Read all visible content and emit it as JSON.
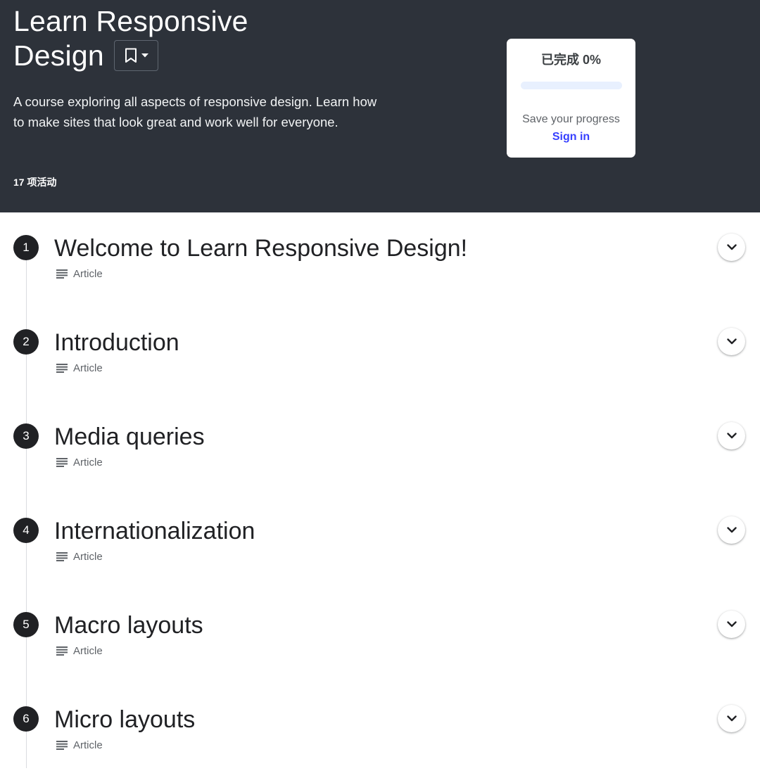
{
  "header": {
    "title": "Learn Responsive\nDesign",
    "description": "A course exploring all aspects of responsive design. Learn how to make sites that look great and work well for everyone.",
    "activity_count": "17 项活动",
    "bookmark_icon": "bookmark-icon",
    "dropdown_icon": "caret-down-icon"
  },
  "progress": {
    "label": "已完成 0%",
    "percent": 0,
    "save_text": "Save your progress",
    "sign_in_label": "Sign in"
  },
  "colors": {
    "header_bg": "#2d323a",
    "accent": "#3740ff",
    "track": "#e8f0fe"
  },
  "lessons": [
    {
      "number": "1",
      "title": "Welcome to Learn Responsive Design!",
      "type": "Article",
      "type_icon": "article-icon"
    },
    {
      "number": "2",
      "title": "Introduction",
      "type": "Article",
      "type_icon": "article-icon"
    },
    {
      "number": "3",
      "title": "Media queries",
      "type": "Article",
      "type_icon": "article-icon"
    },
    {
      "number": "4",
      "title": "Internationalization",
      "type": "Article",
      "type_icon": "article-icon"
    },
    {
      "number": "5",
      "title": "Macro layouts",
      "type": "Article",
      "type_icon": "article-icon"
    },
    {
      "number": "6",
      "title": "Micro layouts",
      "type": "Article",
      "type_icon": "article-icon"
    }
  ]
}
